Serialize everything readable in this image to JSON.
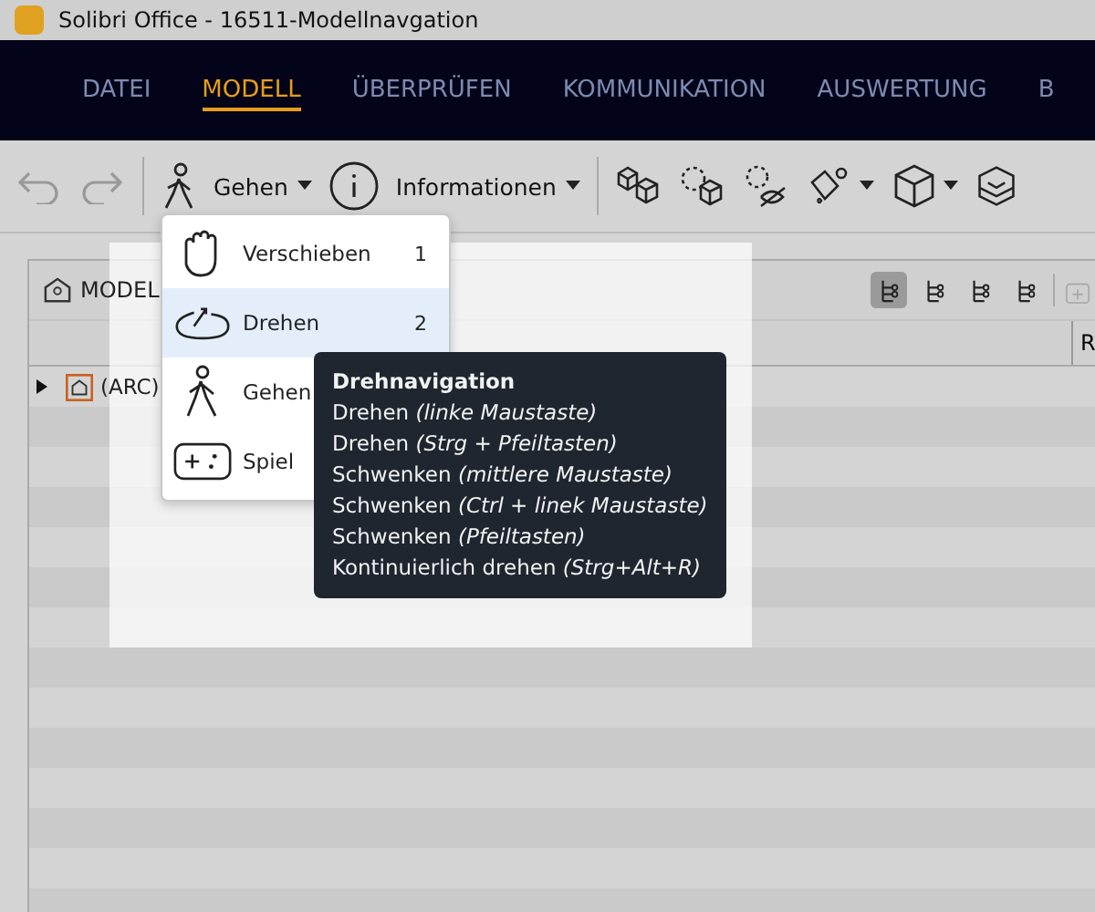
{
  "window": {
    "title": "Solibri Office - 16511-Modellnavgation"
  },
  "tabs": [
    {
      "label": "DATEI",
      "selected": false
    },
    {
      "label": "MODELL",
      "selected": true
    },
    {
      "label": "ÜBERPRÜFEN",
      "selected": false
    },
    {
      "label": "KOMMUNIKATION",
      "selected": false
    },
    {
      "label": "AUSWERTUNG",
      "selected": false
    },
    {
      "label": "B",
      "selected": false
    }
  ],
  "toolbar": {
    "navigation_mode": "Gehen",
    "info": "Informationen"
  },
  "panel": {
    "title": "MODEL",
    "column_1": "R",
    "view_buttons": [
      {
        "selected": true
      },
      {
        "selected": false
      },
      {
        "selected": false
      },
      {
        "selected": false
      }
    ],
    "tree": [
      {
        "label": "(ARC)",
        "expanded": false
      }
    ]
  },
  "menu": {
    "items": [
      {
        "kind": "hand",
        "label": "Verschieben",
        "shortcut": "1",
        "selected": false
      },
      {
        "kind": "orbit",
        "label": "Drehen",
        "shortcut": "2",
        "selected": true
      },
      {
        "kind": "walk",
        "label": "Gehen",
        "selected": false
      },
      {
        "kind": "game",
        "label": "Spiel",
        "selected": false
      }
    ]
  },
  "tooltip": {
    "title": "Drehnavigation",
    "lines": [
      "Drehen *(linke Maustaste)*",
      "Drehen *(Strg + Pfeiltasten)*",
      "Schwenken *(mittlere Maustaste)*",
      "Schwenken *(Ctrl + linek Maustaste)*",
      "Schwenken *(Pfeiltasten)*",
      "Kontinuierlich drehen *(Strg+Alt+R)*"
    ]
  }
}
